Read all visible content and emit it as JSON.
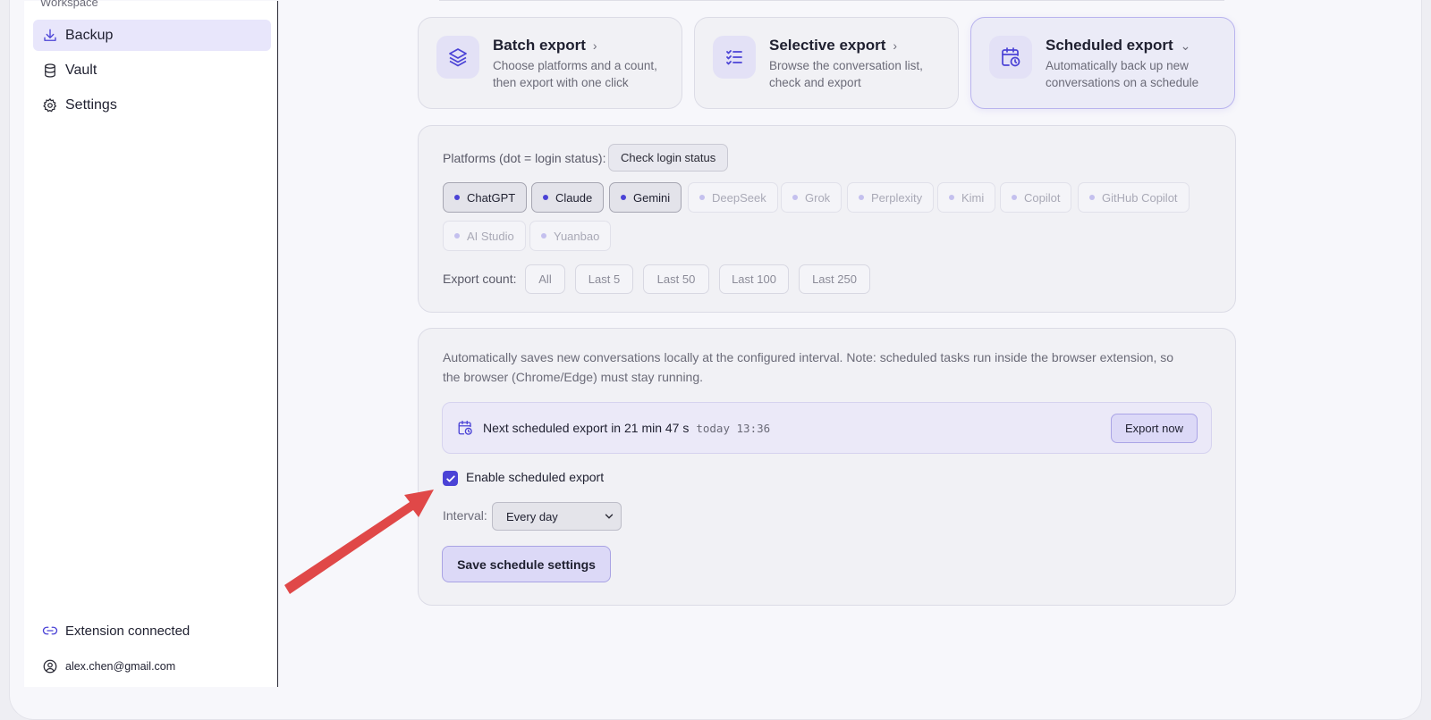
{
  "sidebar": {
    "section_label": "Workspace",
    "items": [
      {
        "label": "Backup",
        "icon": "download-tray-icon",
        "active": true
      },
      {
        "label": "Vault",
        "icon": "database-icon",
        "active": false
      },
      {
        "label": "Settings",
        "icon": "gear-icon",
        "active": false
      }
    ],
    "status": {
      "label": "Extension connected",
      "icon": "link-icon"
    },
    "account": {
      "email": "alex.chen@gmail.com",
      "icon": "user-circle-icon"
    }
  },
  "modes": [
    {
      "title": "Batch export",
      "desc": "Choose platforms and a count, then export with one click",
      "icon": "layers-icon",
      "chevron": "›",
      "active": false
    },
    {
      "title": "Selective export",
      "desc": "Browse the conversation list, check and export",
      "icon": "checklist-icon",
      "chevron": "›",
      "active": false
    },
    {
      "title": "Scheduled export",
      "desc": "Automatically back up new conversations on a schedule",
      "icon": "calendar-clock-icon",
      "chevron": "⌄",
      "active": true
    }
  ],
  "platforms": {
    "label": "Platforms (dot = login status):",
    "check_button": "Check login status",
    "items": [
      {
        "name": "ChatGPT",
        "selected": true
      },
      {
        "name": "Claude",
        "selected": true
      },
      {
        "name": "Gemini",
        "selected": true
      },
      {
        "name": "DeepSeek",
        "selected": false
      },
      {
        "name": "Grok",
        "selected": false
      },
      {
        "name": "Perplexity",
        "selected": false
      },
      {
        "name": "Kimi",
        "selected": false
      },
      {
        "name": "Copilot",
        "selected": false
      },
      {
        "name": "GitHub Copilot",
        "selected": false
      },
      {
        "name": "AI Studio",
        "selected": false
      },
      {
        "name": "Yuanbao",
        "selected": false
      }
    ]
  },
  "export_count": {
    "label": "Export count:",
    "options": [
      "All",
      "Last 5",
      "Last 50",
      "Last 100",
      "Last 250"
    ]
  },
  "schedule": {
    "info": "Automatically saves new conversations locally at the configured interval. Note: scheduled tasks run inside the browser extension, so the browser (Chrome/Edge) must stay running.",
    "next_text": "Next scheduled export in 21 min 47 s",
    "next_time": "today 13:36",
    "export_now": "Export now",
    "enable_label": "Enable scheduled export",
    "enabled": true,
    "interval_label": "Interval:",
    "interval_value": "Every day",
    "save_label": "Save schedule settings"
  },
  "colors": {
    "accent": "#4b43d6",
    "accent_soft": "#dcd9f7",
    "annotation_arrow": "#e04848"
  }
}
